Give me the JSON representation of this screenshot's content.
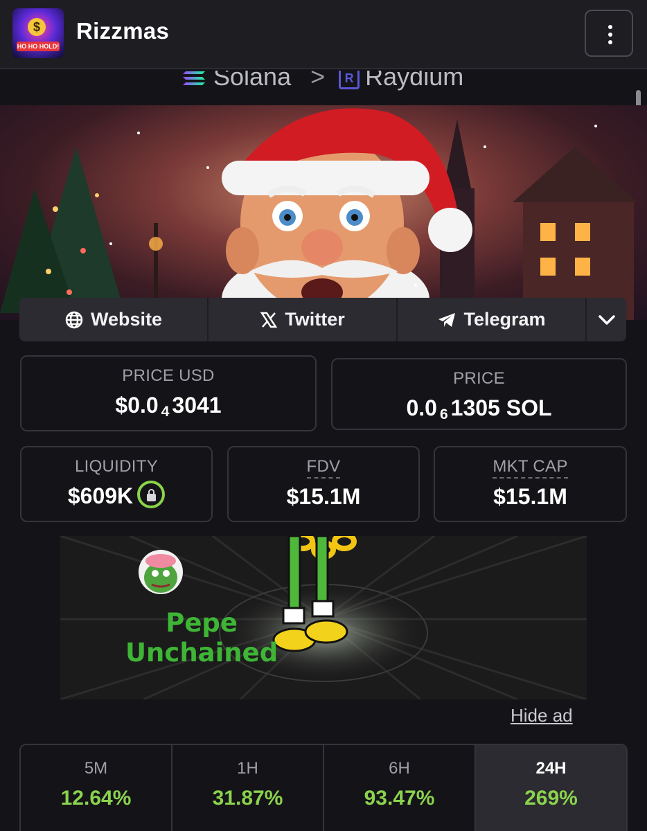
{
  "header": {
    "title": "Rizzmas",
    "logo_badge": "HO HO HOLD!",
    "logo_symbol": "$"
  },
  "breadcrumb": {
    "chain": "Solana",
    "separator": ">",
    "dex": "Raydium",
    "dex_icon_letter": "R"
  },
  "links": [
    {
      "label": "Website",
      "icon": "globe-icon"
    },
    {
      "label": "Twitter",
      "icon": "x-logo-icon"
    },
    {
      "label": "Telegram",
      "icon": "telegram-icon"
    }
  ],
  "stats": {
    "price_usd": {
      "label": "PRICE USD",
      "prefix": "$0.0",
      "sub": "4",
      "suffix": "3041"
    },
    "price": {
      "label": "PRICE",
      "prefix": "0.0",
      "sub": "6",
      "suffix": "1305 SOL"
    },
    "liquidity": {
      "label": "LIQUIDITY",
      "value": "$609K"
    },
    "fdv": {
      "label": "FDV",
      "value": "$15.1M"
    },
    "mkt_cap": {
      "label": "MKT CAP",
      "value": "$15.1M"
    }
  },
  "ad": {
    "line1": "Pepe",
    "line2": "Unchained",
    "hide_label": "Hide ad"
  },
  "changes": [
    {
      "period": "5M",
      "value": "12.64%"
    },
    {
      "period": "1H",
      "value": "31.87%"
    },
    {
      "period": "6H",
      "value": "93.47%"
    },
    {
      "period": "24H",
      "value": "269%"
    }
  ],
  "colors": {
    "positive": "#8bd34d",
    "lock_ring": "#8ad34a",
    "pepe_green": "#3fb536"
  }
}
